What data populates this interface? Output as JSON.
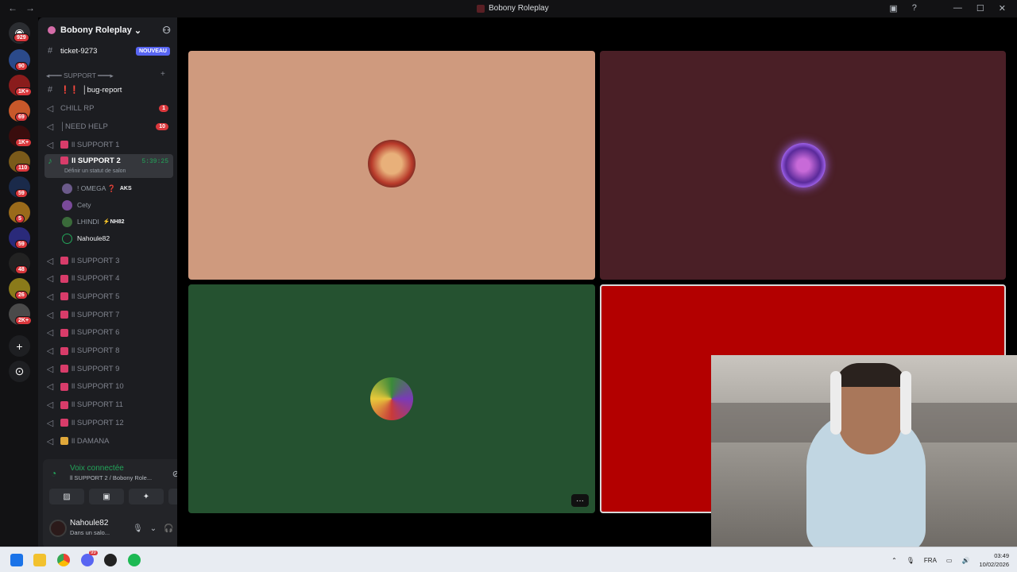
{
  "window": {
    "title": "Bobony Roleplay",
    "back": "←",
    "forward": "→",
    "inbox_icon": "inbox-icon",
    "help_icon": "?",
    "min": "—",
    "max": "☐",
    "close": "✕"
  },
  "rail": {
    "home_badge": "929",
    "servers": [
      {
        "badge": "90",
        "color": "#2b4a8a"
      },
      {
        "badge": "1K+",
        "color": "#8a1c1c"
      },
      {
        "badge": "69",
        "color": "#c8582a"
      },
      {
        "badge": "1K+",
        "color": "#3a0d0d"
      },
      {
        "badge": "110",
        "color": "#7a5a1a"
      },
      {
        "badge": "59",
        "color": "#1a2a4a"
      },
      {
        "badge": "5",
        "color": "#9a6a1a"
      },
      {
        "badge": "59",
        "color": "#2a2a7a"
      },
      {
        "badge": "48",
        "color": "#222222"
      },
      {
        "badge": "26",
        "color": "#8a7a1a"
      },
      {
        "badge": "2K+",
        "color": "#4a4a4a"
      }
    ],
    "add_label": "+",
    "discover_label": "⊙"
  },
  "sidebar": {
    "server_name": "Bobony Roleplay",
    "chevron": "⌄",
    "invite_icon": "add-member-icon",
    "ticket": {
      "name": "ticket-9273",
      "badge": "NOUVEAU"
    },
    "category": "◂━━━ SUPPORT ━━━▸",
    "category_add": "+",
    "bug_report": "│bug-report",
    "channels": [
      {
        "name": "CHILL RP",
        "badge": "1"
      },
      {
        "name": "│NEED HELP",
        "badge": "10"
      },
      {
        "name": "ll SUPPORT 1",
        "badge": ""
      }
    ],
    "active_channel": {
      "name": "ll SUPPORT 2",
      "timer": "5:39:25",
      "sub": "Définir un statut de salon"
    },
    "members": [
      {
        "name": "! OMEGA ❓",
        "tag": "AKS",
        "color": "#6b5a8a"
      },
      {
        "name": "Cety",
        "tag": "",
        "color": "#7a4a9a"
      },
      {
        "name": "LHINDI",
        "tag": "⚡NH82",
        "color": "#3a6a3a"
      },
      {
        "name": "Nahoule82",
        "tag": "",
        "color": "#1e1f22"
      }
    ],
    "more_channels": [
      "ll SUPPORT 3",
      "ll SUPPORT 4",
      "ll SUPPORT 5",
      "ll SUPPORT 7",
      "ll SUPPORT 6",
      "ll SUPPORT 8",
      "ll SUPPORT 9",
      "ll SUPPORT 10",
      "ll SUPPORT 11",
      "ll SUPPORT 12",
      "ll DAMANA"
    ]
  },
  "voice": {
    "status": "Voix connectée",
    "location": "ll SUPPORT 2 / Bobony Role...",
    "buttons": [
      "camera-off",
      "screen-share",
      "activities",
      "soundboard"
    ]
  },
  "user": {
    "name": "Nahoule82",
    "status": "Dans un salo..."
  },
  "tiles": [
    {
      "bg": "#cf9a7e",
      "avatar_color": "#b83a2a"
    },
    {
      "bg": "#4a1f26",
      "avatar_color": "#7a3ab8"
    },
    {
      "bg": "#255230",
      "avatar_color": "#3a8a3a"
    },
    {
      "bg": "#b30000",
      "avatar_color": ""
    }
  ],
  "tile_more": "···",
  "taskbar": {
    "lang": "FRA",
    "time": "03:49",
    "date": "10/02/2026",
    "discord_badge": "99"
  }
}
